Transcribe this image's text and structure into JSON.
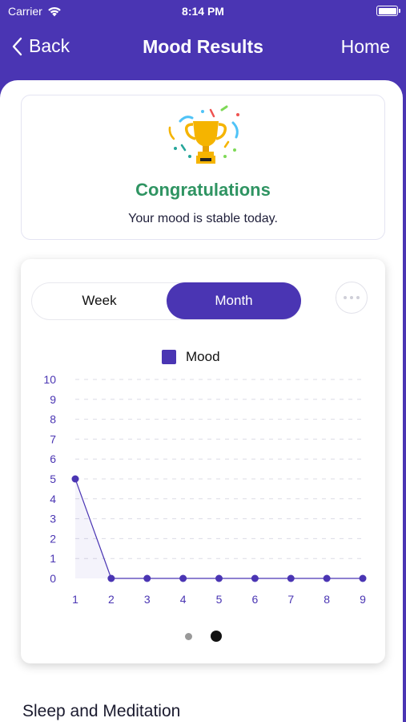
{
  "status_bar": {
    "carrier": "Carrier",
    "time": "8:14 PM"
  },
  "nav": {
    "back_label": "Back",
    "title": "Mood Results",
    "home_label": "Home"
  },
  "congrats": {
    "title": "Congratulations",
    "subtitle": "Your mood is stable today."
  },
  "segment": {
    "week_label": "Week",
    "month_label": "Month",
    "selected": "Month"
  },
  "legend": {
    "label": "Mood"
  },
  "colors": {
    "accent": "#4a35b3",
    "success": "#2f9462"
  },
  "pager": {
    "count": 2,
    "active_index": 1
  },
  "section": {
    "title": "Sleep and Meditation"
  },
  "chart_data": {
    "type": "line",
    "title": "",
    "xlabel": "",
    "ylabel": "",
    "x": [
      1,
      2,
      3,
      4,
      5,
      6,
      7,
      8,
      9
    ],
    "series": [
      {
        "name": "Mood",
        "values": [
          5,
          0,
          0,
          0,
          0,
          0,
          0,
          0,
          0
        ]
      }
    ],
    "y_ticks": [
      0,
      1,
      2,
      3,
      4,
      5,
      6,
      7,
      8,
      9,
      10
    ],
    "ylim": [
      0,
      10
    ],
    "grid": true,
    "legend_position": "top-center"
  }
}
